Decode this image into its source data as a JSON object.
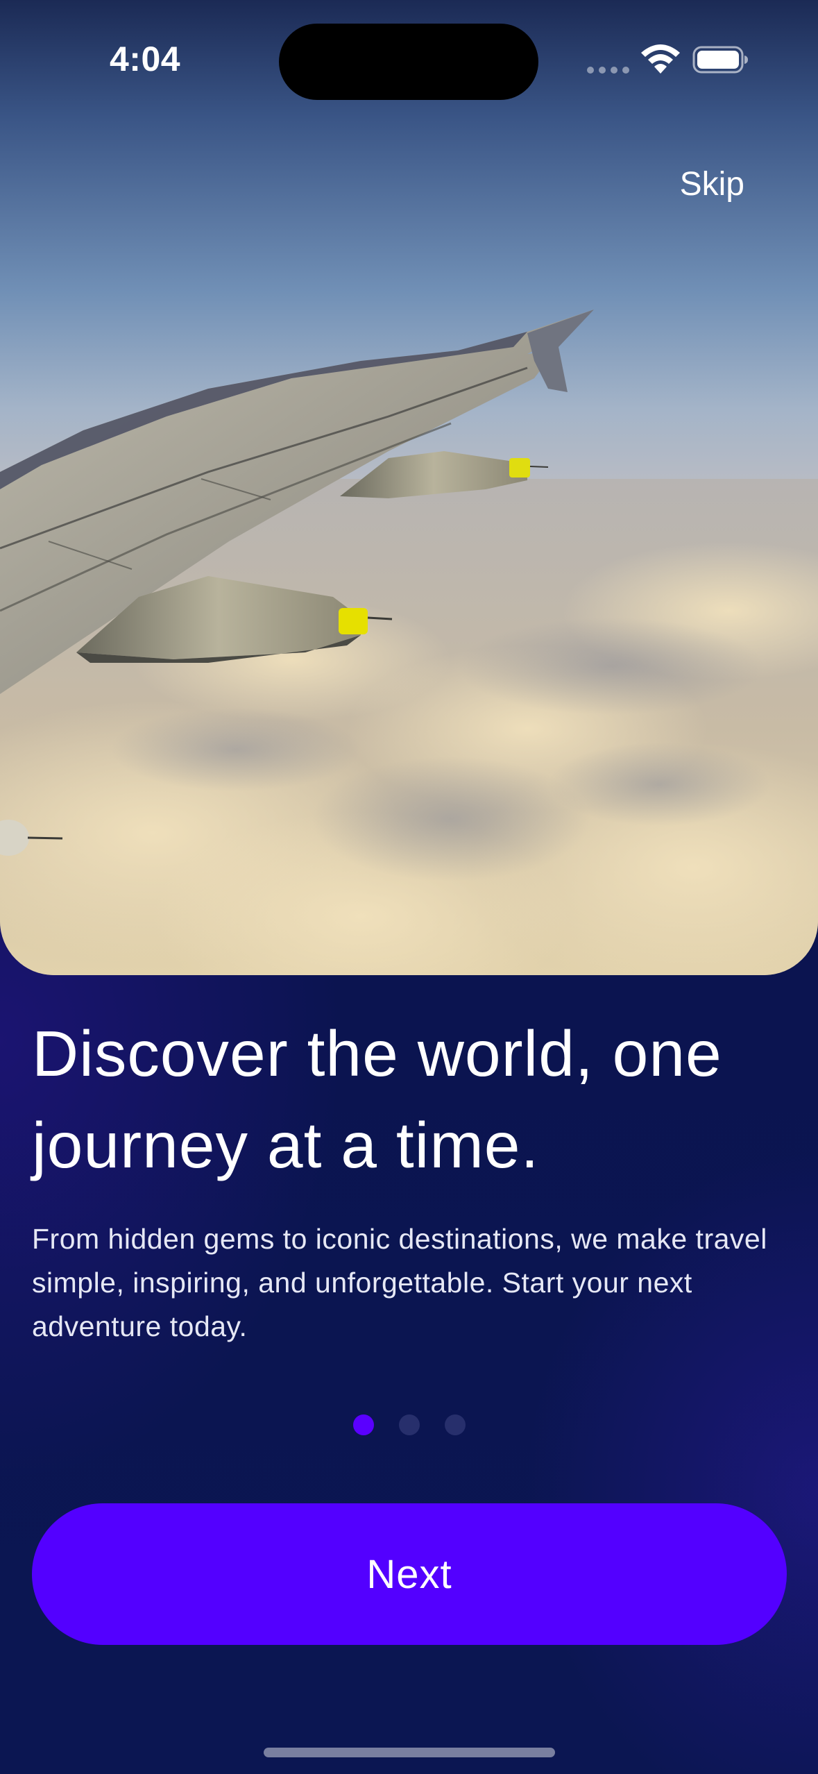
{
  "status_bar": {
    "time": "4:04"
  },
  "hero": {
    "image": "airplane-wing-above-clouds"
  },
  "header": {
    "skip_label": "Skip"
  },
  "content": {
    "headline": "Discover the world, one journey at a time.",
    "description": "From hidden gems to iconic destinations, we make travel simple, inspiring, and unforgettable. Start your next adventure today."
  },
  "pagination": {
    "total": 3,
    "active_index": 0
  },
  "actions": {
    "next_label": "Next"
  },
  "colors": {
    "background": "#0b1450",
    "accent": "#5300ff",
    "dot_inactive": "#272f6c"
  }
}
